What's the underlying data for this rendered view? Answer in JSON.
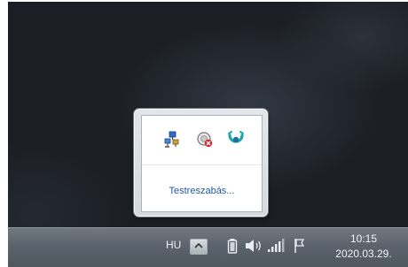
{
  "overflow": {
    "icons": [
      "network-icon",
      "security-shield-icon",
      "cloud-app-icon"
    ],
    "customize_label": "Testreszabás..."
  },
  "taskbar": {
    "language": "HU",
    "time": "10:15",
    "date": "2020.03.29."
  }
}
